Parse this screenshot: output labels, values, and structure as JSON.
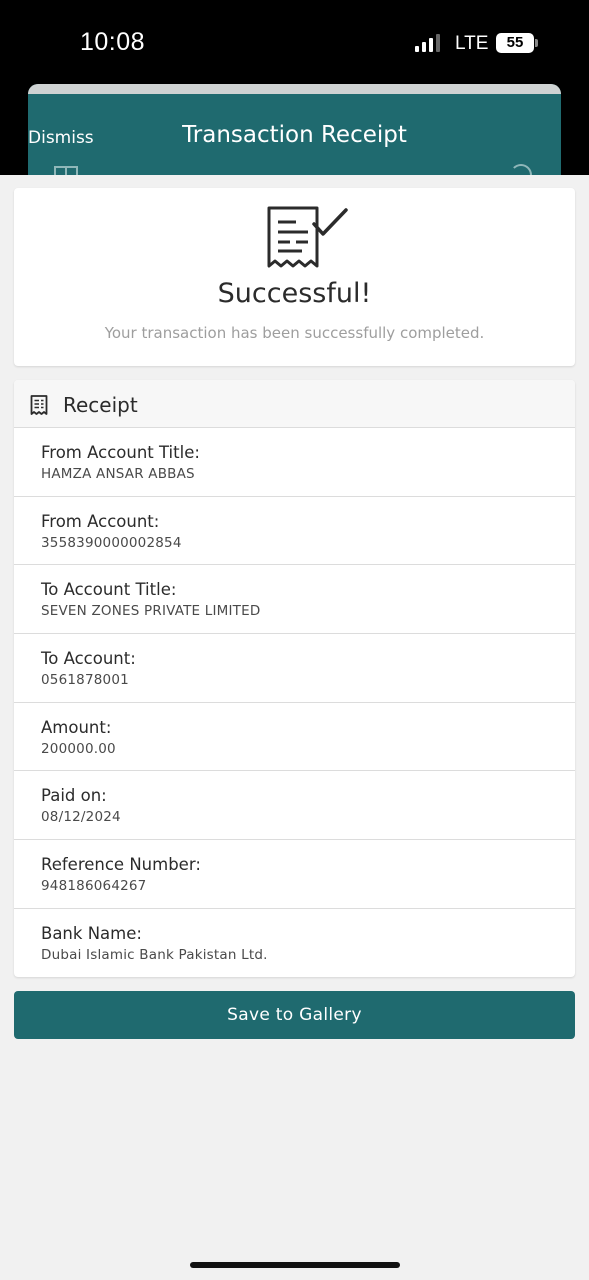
{
  "status_bar": {
    "time": "10:08",
    "network": "LTE",
    "battery": "55"
  },
  "header": {
    "dismiss_label": "Dismiss",
    "title": "Transaction Receipt",
    "background_color": "#1f6a6f"
  },
  "success": {
    "icon": "receipt-check-icon",
    "title": "Successful!",
    "message": "Your transaction has been successfully completed."
  },
  "receipt": {
    "icon": "receipt-icon",
    "header_label": "Receipt",
    "rows": [
      {
        "label": "From Account Title:",
        "value": "HAMZA ANSAR ABBAS"
      },
      {
        "label": "From Account:",
        "value": "3558390000002854"
      },
      {
        "label": "To Account Title:",
        "value": "SEVEN ZONES PRIVATE LIMITED"
      },
      {
        "label": "To Account:",
        "value": "0561878001"
      },
      {
        "label": "Amount:",
        "value": "200000.00"
      },
      {
        "label": "Paid on:",
        "value": "08/12/2024"
      },
      {
        "label": "Reference Number:",
        "value": "948186064267"
      },
      {
        "label": "Bank Name:",
        "value": "Dubai Islamic Bank Pakistan Ltd."
      }
    ]
  },
  "actions": {
    "save_label": "Save to Gallery",
    "accent_color": "#1f6a6f"
  }
}
